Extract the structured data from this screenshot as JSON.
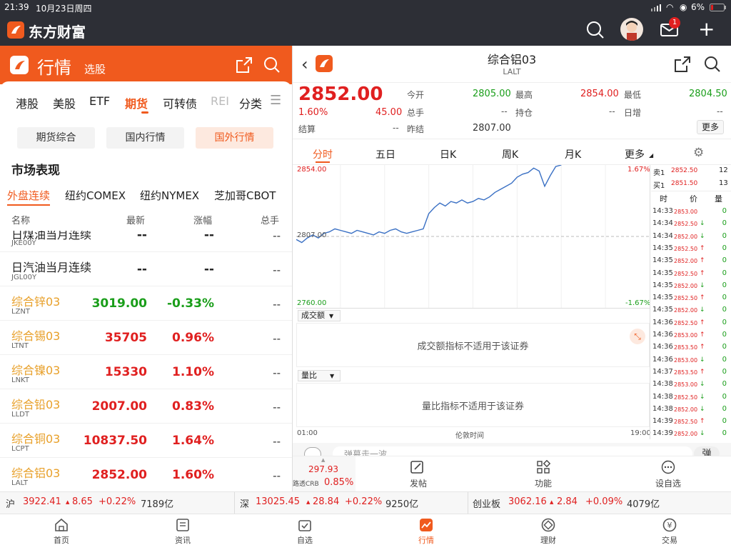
{
  "status": {
    "time": "21:39",
    "date": "10月23日周四",
    "battery": "6%"
  },
  "appbar": {
    "brand": "东方财富",
    "mail_badge": "1"
  },
  "left": {
    "title": "行情",
    "subtitle": "选股",
    "market_tabs": [
      "港股",
      "美股",
      "ETF",
      "期货",
      "可转债",
      "REI",
      "分类"
    ],
    "active_market_tab": "期货",
    "sub_tabs": [
      "期货综合",
      "国内行情",
      "国外行情"
    ],
    "active_sub_tab": "国外行情",
    "section_title": "市场表现",
    "exchange_tabs": [
      "外盘连续",
      "纽约COMEX",
      "纽约NYMEX",
      "芝加哥CBOT"
    ],
    "active_exchange_tab": "外盘连续",
    "columns": [
      "名称",
      "最新",
      "涨幅",
      "总手"
    ],
    "rows": [
      {
        "name": "日煤油当月连续",
        "code": "JKE00Y",
        "price": "--",
        "change": "--",
        "total": "--"
      },
      {
        "name": "日汽油当月连续",
        "code": "JGL00Y",
        "price": "--",
        "change": "--",
        "total": "--"
      },
      {
        "name": "综合锌03",
        "code": "LZNT",
        "price": "3019.00",
        "change": "-0.33%",
        "total": "--"
      },
      {
        "name": "综合锡03",
        "code": "LTNT",
        "price": "35705",
        "change": "0.96%",
        "total": "--"
      },
      {
        "name": "综合镍03",
        "code": "LNKT",
        "price": "15330",
        "change": "1.10%",
        "total": "--"
      },
      {
        "name": "综合铅03",
        "code": "LLDT",
        "price": "2007.00",
        "change": "0.83%",
        "total": "--"
      },
      {
        "name": "综合铜03",
        "code": "LCPT",
        "price": "10837.50",
        "change": "1.64%",
        "total": "--"
      },
      {
        "name": "综合铝03",
        "code": "LALT",
        "price": "2852.00",
        "change": "1.60%",
        "total": "--"
      }
    ]
  },
  "right": {
    "title": "综合铝03",
    "code": "LALT",
    "price": "2852.00",
    "pct": "1.60%",
    "chg": "45.00",
    "settle_label": "结算",
    "settle": "--",
    "open_label": "今开",
    "open": "2805.00",
    "high_label": "最高",
    "high": "2854.00",
    "low_label": "最低",
    "low": "2804.50",
    "vol_label": "总手",
    "vol": "--",
    "oi_label": "持仓",
    "oi": "--",
    "daily_label": "日增",
    "daily": "--",
    "prev_label": "昨结",
    "prev": "2807.00",
    "more_btn": "更多",
    "chart_tabs": [
      "分时",
      "五日",
      "日K",
      "周K",
      "月K",
      "更多"
    ],
    "active_chart_tab": "分时",
    "chart_top": "2854.00",
    "chart_top_pct": "1.67%",
    "chart_bottom": "2760.00",
    "chart_bottom_pct": "-1.67%",
    "chart_mid": "2807.00",
    "sell1_label": "卖1",
    "sell1_price": "2852.50",
    "sell1_vol": "12",
    "buy1_label": "买1",
    "buy1_price": "2851.50",
    "buy1_vol": "13",
    "tick_header": [
      "时",
      "价",
      "量"
    ],
    "ticks": [
      {
        "t": "14:33",
        "p": "2853.00",
        "a": "",
        "v": "0"
      },
      {
        "t": "14:34",
        "p": "2852.50",
        "a": "↓",
        "v": "0"
      },
      {
        "t": "14:34",
        "p": "2852.00",
        "a": "↓",
        "v": "0"
      },
      {
        "t": "14:35",
        "p": "2852.50",
        "a": "↑",
        "v": "0"
      },
      {
        "t": "14:35",
        "p": "2852.00",
        "a": "↑",
        "v": "0"
      },
      {
        "t": "14:35",
        "p": "2852.50",
        "a": "↑",
        "v": "0"
      },
      {
        "t": "14:35",
        "p": "2852.00",
        "a": "↓",
        "v": "0"
      },
      {
        "t": "14:35",
        "p": "2852.50",
        "a": "↑",
        "v": "0"
      },
      {
        "t": "14:35",
        "p": "2852.00",
        "a": "↓",
        "v": "0"
      },
      {
        "t": "14:36",
        "p": "2852.50",
        "a": "↑",
        "v": "0"
      },
      {
        "t": "14:36",
        "p": "2853.00",
        "a": "↑",
        "v": "0"
      },
      {
        "t": "14:36",
        "p": "2853.50",
        "a": "↑",
        "v": "0"
      },
      {
        "t": "14:36",
        "p": "2853.00",
        "a": "↓",
        "v": "0"
      },
      {
        "t": "14:37",
        "p": "2853.50",
        "a": "↑",
        "v": "0"
      },
      {
        "t": "14:38",
        "p": "2853.00",
        "a": "↓",
        "v": "0"
      },
      {
        "t": "14:38",
        "p": "2852.50",
        "a": "↓",
        "v": "0"
      },
      {
        "t": "14:38",
        "p": "2852.00",
        "a": "↓",
        "v": "0"
      },
      {
        "t": "14:39",
        "p": "2852.50",
        "a": "↑",
        "v": "0"
      },
      {
        "t": "14:39",
        "p": "2852.00",
        "a": "↓",
        "v": "0"
      }
    ],
    "volume_select": "成交额",
    "volume_msg": "成交额指标不适用于该证券",
    "ratio_select": "量比",
    "ratio_msg": "量比指标不适用于该证券",
    "time_start": "01:00",
    "time_mid": "伦敦时间",
    "time_end": "19:00",
    "comment_placeholder": "弹幕走一波",
    "comment_btn": "弹",
    "related_value": "297.93",
    "related_name": "路透CRB",
    "related_pct": "0.85%",
    "actions": [
      "发帖",
      "功能",
      "设自选"
    ]
  },
  "chart_data": {
    "type": "line",
    "title": "综合铝03 分时",
    "ylim": [
      2760.0,
      2854.0
    ],
    "reference": 2807.0,
    "x_labels": [
      "01:00",
      "19:00"
    ],
    "values": [
      2805,
      2803,
      2806,
      2808,
      2806,
      2809,
      2810,
      2812,
      2811,
      2810,
      2809,
      2811,
      2810,
      2809,
      2808,
      2810,
      2809,
      2811,
      2812,
      2810,
      2809,
      2810,
      2811,
      2812,
      2822,
      2826,
      2829,
      2827,
      2830,
      2829,
      2831,
      2829,
      2830,
      2832,
      2831,
      2833,
      2836,
      2838,
      2840,
      2842,
      2846,
      2848,
      2849,
      2852,
      2850,
      2840,
      2847,
      2853,
      2854
    ]
  },
  "indices": [
    {
      "name": "沪",
      "value": "3922.41",
      "chg": "8.65",
      "pct": "+0.22%",
      "amt": "7189亿"
    },
    {
      "name": "深",
      "value": "13025.45",
      "chg": "28.84",
      "pct": "+0.22%",
      "amt": "9250亿"
    },
    {
      "name": "创业板",
      "value": "3062.16",
      "chg": "2.84",
      "pct": "+0.09%",
      "amt": "4079亿"
    }
  ],
  "nav": [
    "首页",
    "资讯",
    "自选",
    "行情",
    "理财",
    "交易"
  ],
  "active_nav": "行情",
  "colors": {
    "brand": "#f05a1e",
    "up": "#e02020",
    "down": "#1a9e1a",
    "line": "#3a70c4"
  }
}
